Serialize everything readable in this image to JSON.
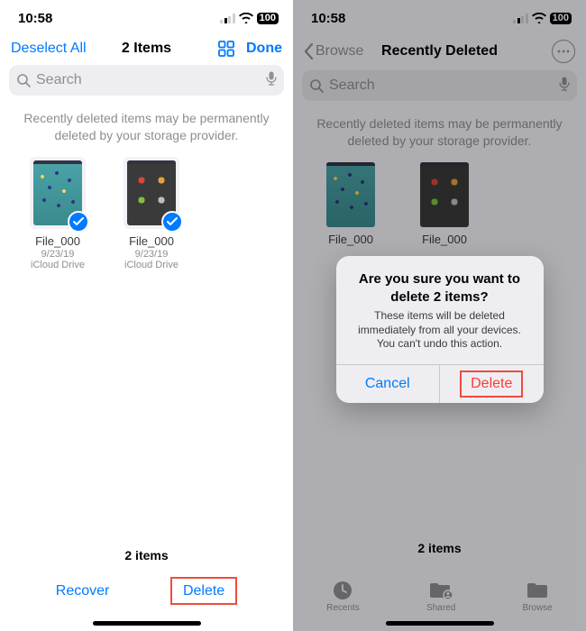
{
  "left": {
    "status": {
      "time": "10:58",
      "battery": "100"
    },
    "nav": {
      "deselect": "Deselect All",
      "title": "2 Items",
      "done": "Done"
    },
    "search": {
      "placeholder": "Search"
    },
    "info": "Recently deleted items may be permanently deleted by your storage provider.",
    "files": [
      {
        "name": "File_000",
        "date": "9/23/19",
        "loc": "iCloud Drive"
      },
      {
        "name": "File_000",
        "date": "9/23/19",
        "loc": "iCloud Drive"
      }
    ],
    "footer_count": "2 items",
    "toolbar": {
      "recover": "Recover",
      "delete": "Delete"
    }
  },
  "right": {
    "status": {
      "time": "10:58",
      "battery": "100"
    },
    "nav": {
      "back": "Browse",
      "title": "Recently Deleted"
    },
    "search": {
      "placeholder": "Search"
    },
    "info": "Recently deleted items may be permanently deleted by your storage provider.",
    "files": [
      {
        "name": "File_000"
      },
      {
        "name": "File_000"
      }
    ],
    "footer_count": "2 items",
    "tabs": {
      "recents": "Recents",
      "shared": "Shared",
      "browse": "Browse"
    },
    "alert": {
      "title": "Are you sure you want to delete 2 items?",
      "msg": "These items will be deleted immediately from all your devices. You can't undo this action.",
      "cancel": "Cancel",
      "delete": "Delete"
    }
  }
}
